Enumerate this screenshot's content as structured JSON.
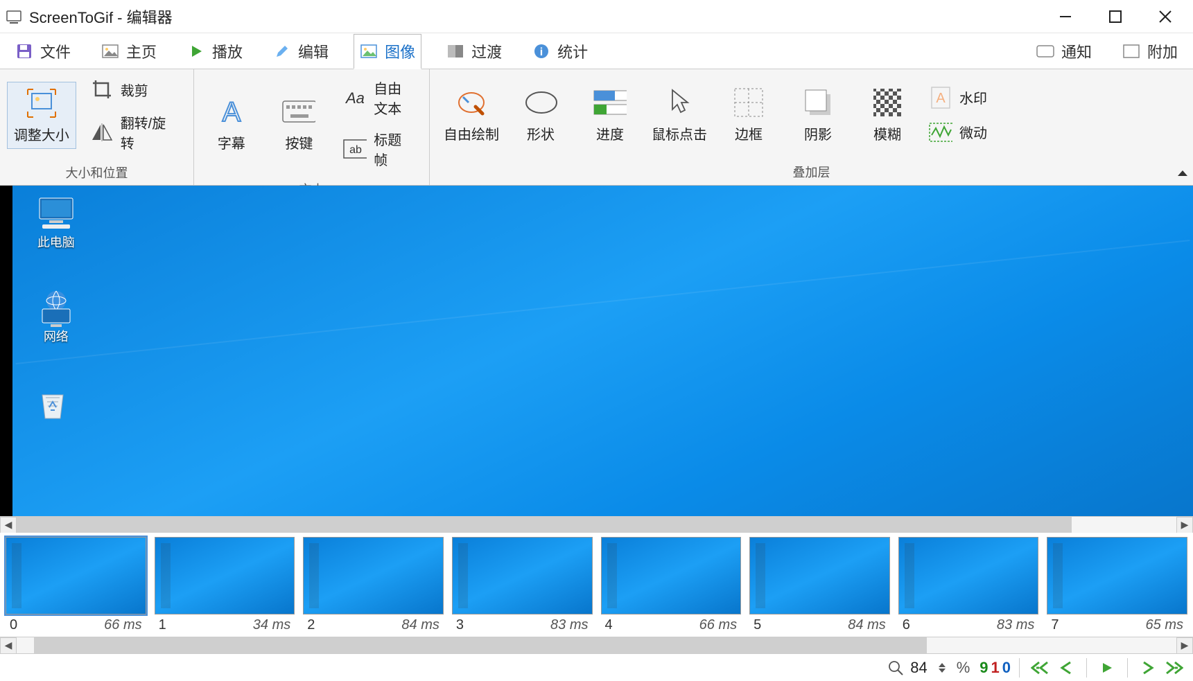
{
  "title": "ScreenToGif - 编辑器",
  "tabs": {
    "file": "文件",
    "home": "主页",
    "play": "播放",
    "edit": "编辑",
    "image": "图像",
    "transition": "过渡",
    "stats": "统计",
    "notify": "通知",
    "extras": "附加"
  },
  "ribbon": {
    "group_size": "大小和位置",
    "group_text": "文本",
    "group_overlay": "叠加层",
    "resize": "调整大小",
    "crop": "裁剪",
    "flip": "翻转/旋转",
    "caption": "字幕",
    "keys": "按键",
    "freetext": "自由文本",
    "titleframe": "标题帧",
    "freedraw": "自由绘制",
    "shape": "形状",
    "progress": "进度",
    "click": "鼠标点击",
    "border": "边框",
    "shadow": "阴影",
    "blur": "模糊",
    "watermark": "水印",
    "jitter": "微动"
  },
  "desktop": {
    "pc": "此电脑",
    "net": "网络"
  },
  "frames": [
    {
      "idx": "0",
      "dur": "66 ms"
    },
    {
      "idx": "1",
      "dur": "34 ms"
    },
    {
      "idx": "2",
      "dur": "84 ms"
    },
    {
      "idx": "3",
      "dur": "83 ms"
    },
    {
      "idx": "4",
      "dur": "66 ms"
    },
    {
      "idx": "5",
      "dur": "84 ms"
    },
    {
      "idx": "6",
      "dur": "83 ms"
    },
    {
      "idx": "7",
      "dur": "65 ms"
    }
  ],
  "status": {
    "zoom": "84",
    "pct": "%",
    "total": "9",
    "sel": "1",
    "clip": "0"
  }
}
